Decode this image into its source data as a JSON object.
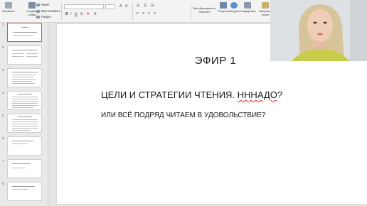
{
  "ribbon": {
    "groups": [
      {
        "id": "insert",
        "label": "Вставить"
      },
      {
        "id": "new-slide",
        "label": "Создать слайд"
      }
    ],
    "slide_group": {
      "layout": "Макет",
      "reset": "Восстановить",
      "section": "Раздел"
    },
    "font_name": "",
    "font_size": "",
    "convert_smartart": "Преобразовать в SmartArt",
    "pictures": "Рисунок",
    "shapes": "Фигуры",
    "arrange": "Упорядочить",
    "quick_styles": "Экспресс-стили"
  },
  "thumbnails": [
    {
      "number": "1",
      "selected": true
    },
    {
      "number": "2",
      "selected": false
    },
    {
      "number": "3",
      "selected": false
    },
    {
      "number": "4",
      "selected": false
    },
    {
      "number": "5",
      "selected": false
    },
    {
      "number": "6",
      "selected": false
    },
    {
      "number": "7",
      "selected": false
    },
    {
      "number": "8",
      "selected": false
    }
  ],
  "slide": {
    "number_text": "ЭФИР 1",
    "title_plain": "ЦЕЛИ И СТРАТЕГИИ ЧТЕНИЯ. ",
    "title_misspelled": "НННАДО",
    "title_end": "?",
    "subtitle": "ИЛИ ВСЁ ПОДРЯД ЧИТАЕМ В УДОВОЛЬСТВИЕ?"
  },
  "colors": {
    "accent": "#c65a3a",
    "spellcheck": "#d9342b",
    "slide_bg": "#ffffff"
  }
}
